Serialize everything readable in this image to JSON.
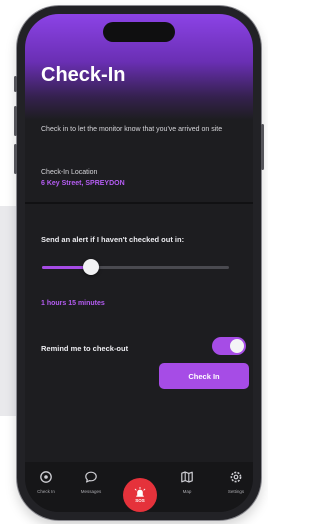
{
  "screen": {
    "title": "Check-In",
    "intro_text": "Check in to let the monitor know that you've arrived on site"
  },
  "location": {
    "label": "Check-In Location",
    "value": "6 Key Street,  SPREYDON"
  },
  "alert": {
    "label": "Send an alert if I haven't checked out in:",
    "duration_text": "1 hours 15 minutes",
    "slider_fraction": 0.26
  },
  "reminder": {
    "label": "Remind me to check-out",
    "enabled": true
  },
  "actions": {
    "check_in_label": "Check In"
  },
  "tabbar": {
    "items": [
      {
        "label": "Check In",
        "icon": "location-pin-icon"
      },
      {
        "label": "Messages",
        "icon": "chat-bubble-icon"
      },
      {
        "label": "SOS",
        "icon": "alarm-icon"
      },
      {
        "label": "Map",
        "icon": "map-icon"
      },
      {
        "label": "Settings",
        "icon": "gear-icon"
      }
    ]
  },
  "colors": {
    "accent": "#a64ce6",
    "header_top": "#8c43e6",
    "background": "#1d1d20",
    "sos": "#e5323b"
  }
}
